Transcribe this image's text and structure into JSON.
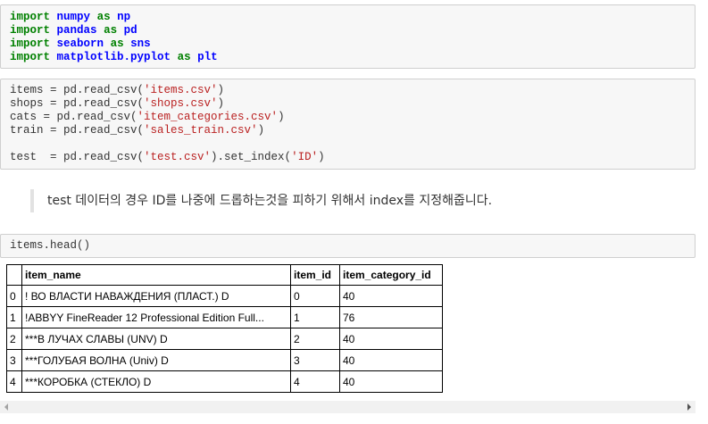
{
  "cells": {
    "imports": [
      [
        [
          "kw",
          "import"
        ],
        [
          "t",
          " "
        ],
        [
          "mod",
          "numpy"
        ],
        [
          "t",
          " "
        ],
        [
          "kw",
          "as"
        ],
        [
          "t",
          " "
        ],
        [
          "mod",
          "np"
        ]
      ],
      [
        [
          "kw",
          "import"
        ],
        [
          "t",
          " "
        ],
        [
          "mod",
          "pandas"
        ],
        [
          "t",
          " "
        ],
        [
          "kw",
          "as"
        ],
        [
          "t",
          " "
        ],
        [
          "mod",
          "pd"
        ]
      ],
      [
        [
          "kw",
          "import"
        ],
        [
          "t",
          " "
        ],
        [
          "mod",
          "seaborn"
        ],
        [
          "t",
          " "
        ],
        [
          "kw",
          "as"
        ],
        [
          "t",
          " "
        ],
        [
          "mod",
          "sns"
        ]
      ],
      [
        [
          "kw",
          "import"
        ],
        [
          "t",
          " "
        ],
        [
          "mod",
          "matplotlib.pyplot"
        ],
        [
          "t",
          " "
        ],
        [
          "kw",
          "as"
        ],
        [
          "t",
          " "
        ],
        [
          "mod",
          "plt"
        ]
      ]
    ],
    "read_csv": [
      [
        [
          "t",
          "items = pd.read_csv("
        ],
        [
          "str",
          "'items.csv'"
        ],
        [
          "t",
          ")"
        ]
      ],
      [
        [
          "t",
          "shops = pd.read_csv("
        ],
        [
          "str",
          "'shops.csv'"
        ],
        [
          "t",
          ")"
        ]
      ],
      [
        [
          "t",
          "cats = pd.read_csv("
        ],
        [
          "str",
          "'item_categories.csv'"
        ],
        [
          "t",
          ")"
        ]
      ],
      [
        [
          "t",
          "train = pd.read_csv("
        ],
        [
          "str",
          "'sales_train.csv'"
        ],
        [
          "t",
          ")"
        ]
      ],
      [
        [
          "t",
          ""
        ]
      ],
      [
        [
          "t",
          "test  = pd.read_csv("
        ],
        [
          "str",
          "'test.csv'"
        ],
        [
          "t",
          ").set_index("
        ],
        [
          "str",
          "'ID'"
        ],
        [
          "t",
          ")"
        ]
      ]
    ],
    "head": [
      [
        [
          "t",
          "items.head()"
        ]
      ]
    ]
  },
  "markdown": {
    "text": "test 데이터의 경우 ID를 나중에 드롭하는것을 피하기 위해서 index를 지정해줍니다."
  },
  "dataframe": {
    "columns": [
      "",
      "item_name",
      "item_id",
      "item_category_id"
    ],
    "rows": [
      [
        "0",
        "! ВО ВЛАСТИ НАВАЖДЕНИЯ (ПЛАСТ.) D",
        "0",
        "40"
      ],
      [
        "1",
        "!ABBYY FineReader 12 Professional Edition Full...",
        "1",
        "76"
      ],
      [
        "2",
        "***В ЛУЧАХ СЛАВЫ (UNV) D",
        "2",
        "40"
      ],
      [
        "3",
        "***ГОЛУБАЯ ВОЛНА (Univ) D",
        "3",
        "40"
      ],
      [
        "4",
        "***КОРОБКА (СТЕКЛО) D",
        "4",
        "40"
      ]
    ]
  },
  "colors": {
    "keyword": "#008000",
    "module": "#0000ff",
    "string": "#ba2121",
    "cell_bg": "#f7f7f7",
    "cell_border": "#cfcfcf"
  },
  "icons": {
    "scroll_left": "left-arrow-icon",
    "scroll_right": "right-arrow-icon"
  }
}
